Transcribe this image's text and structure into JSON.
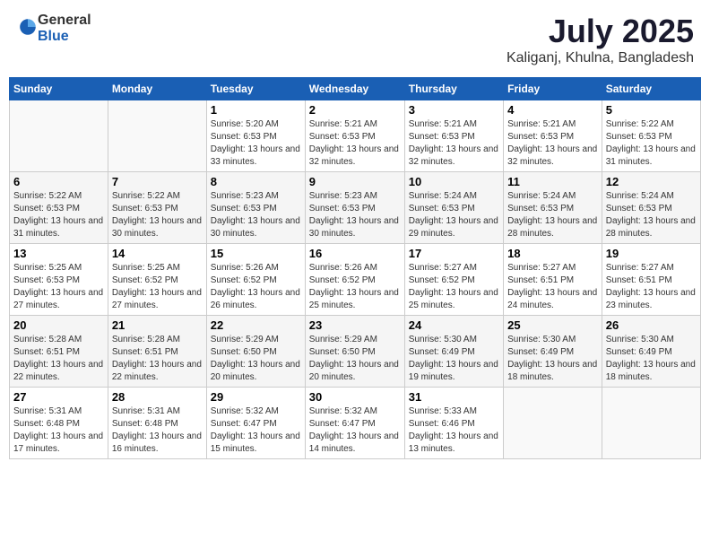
{
  "header": {
    "logo_general": "General",
    "logo_blue": "Blue",
    "month_title": "July 2025",
    "location": "Kaliganj, Khulna, Bangladesh"
  },
  "weekdays": [
    "Sunday",
    "Monday",
    "Tuesday",
    "Wednesday",
    "Thursday",
    "Friday",
    "Saturday"
  ],
  "weeks": [
    [
      {
        "day": "",
        "info": ""
      },
      {
        "day": "",
        "info": ""
      },
      {
        "day": "1",
        "info": "Sunrise: 5:20 AM\nSunset: 6:53 PM\nDaylight: 13 hours and 33 minutes."
      },
      {
        "day": "2",
        "info": "Sunrise: 5:21 AM\nSunset: 6:53 PM\nDaylight: 13 hours and 32 minutes."
      },
      {
        "day": "3",
        "info": "Sunrise: 5:21 AM\nSunset: 6:53 PM\nDaylight: 13 hours and 32 minutes."
      },
      {
        "day": "4",
        "info": "Sunrise: 5:21 AM\nSunset: 6:53 PM\nDaylight: 13 hours and 32 minutes."
      },
      {
        "day": "5",
        "info": "Sunrise: 5:22 AM\nSunset: 6:53 PM\nDaylight: 13 hours and 31 minutes."
      }
    ],
    [
      {
        "day": "6",
        "info": "Sunrise: 5:22 AM\nSunset: 6:53 PM\nDaylight: 13 hours and 31 minutes."
      },
      {
        "day": "7",
        "info": "Sunrise: 5:22 AM\nSunset: 6:53 PM\nDaylight: 13 hours and 30 minutes."
      },
      {
        "day": "8",
        "info": "Sunrise: 5:23 AM\nSunset: 6:53 PM\nDaylight: 13 hours and 30 minutes."
      },
      {
        "day": "9",
        "info": "Sunrise: 5:23 AM\nSunset: 6:53 PM\nDaylight: 13 hours and 30 minutes."
      },
      {
        "day": "10",
        "info": "Sunrise: 5:24 AM\nSunset: 6:53 PM\nDaylight: 13 hours and 29 minutes."
      },
      {
        "day": "11",
        "info": "Sunrise: 5:24 AM\nSunset: 6:53 PM\nDaylight: 13 hours and 28 minutes."
      },
      {
        "day": "12",
        "info": "Sunrise: 5:24 AM\nSunset: 6:53 PM\nDaylight: 13 hours and 28 minutes."
      }
    ],
    [
      {
        "day": "13",
        "info": "Sunrise: 5:25 AM\nSunset: 6:53 PM\nDaylight: 13 hours and 27 minutes."
      },
      {
        "day": "14",
        "info": "Sunrise: 5:25 AM\nSunset: 6:52 PM\nDaylight: 13 hours and 27 minutes."
      },
      {
        "day": "15",
        "info": "Sunrise: 5:26 AM\nSunset: 6:52 PM\nDaylight: 13 hours and 26 minutes."
      },
      {
        "day": "16",
        "info": "Sunrise: 5:26 AM\nSunset: 6:52 PM\nDaylight: 13 hours and 25 minutes."
      },
      {
        "day": "17",
        "info": "Sunrise: 5:27 AM\nSunset: 6:52 PM\nDaylight: 13 hours and 25 minutes."
      },
      {
        "day": "18",
        "info": "Sunrise: 5:27 AM\nSunset: 6:51 PM\nDaylight: 13 hours and 24 minutes."
      },
      {
        "day": "19",
        "info": "Sunrise: 5:27 AM\nSunset: 6:51 PM\nDaylight: 13 hours and 23 minutes."
      }
    ],
    [
      {
        "day": "20",
        "info": "Sunrise: 5:28 AM\nSunset: 6:51 PM\nDaylight: 13 hours and 22 minutes."
      },
      {
        "day": "21",
        "info": "Sunrise: 5:28 AM\nSunset: 6:51 PM\nDaylight: 13 hours and 22 minutes."
      },
      {
        "day": "22",
        "info": "Sunrise: 5:29 AM\nSunset: 6:50 PM\nDaylight: 13 hours and 20 minutes."
      },
      {
        "day": "23",
        "info": "Sunrise: 5:29 AM\nSunset: 6:50 PM\nDaylight: 13 hours and 20 minutes."
      },
      {
        "day": "24",
        "info": "Sunrise: 5:30 AM\nSunset: 6:49 PM\nDaylight: 13 hours and 19 minutes."
      },
      {
        "day": "25",
        "info": "Sunrise: 5:30 AM\nSunset: 6:49 PM\nDaylight: 13 hours and 18 minutes."
      },
      {
        "day": "26",
        "info": "Sunrise: 5:30 AM\nSunset: 6:49 PM\nDaylight: 13 hours and 18 minutes."
      }
    ],
    [
      {
        "day": "27",
        "info": "Sunrise: 5:31 AM\nSunset: 6:48 PM\nDaylight: 13 hours and 17 minutes."
      },
      {
        "day": "28",
        "info": "Sunrise: 5:31 AM\nSunset: 6:48 PM\nDaylight: 13 hours and 16 minutes."
      },
      {
        "day": "29",
        "info": "Sunrise: 5:32 AM\nSunset: 6:47 PM\nDaylight: 13 hours and 15 minutes."
      },
      {
        "day": "30",
        "info": "Sunrise: 5:32 AM\nSunset: 6:47 PM\nDaylight: 13 hours and 14 minutes."
      },
      {
        "day": "31",
        "info": "Sunrise: 5:33 AM\nSunset: 6:46 PM\nDaylight: 13 hours and 13 minutes."
      },
      {
        "day": "",
        "info": ""
      },
      {
        "day": "",
        "info": ""
      }
    ]
  ]
}
